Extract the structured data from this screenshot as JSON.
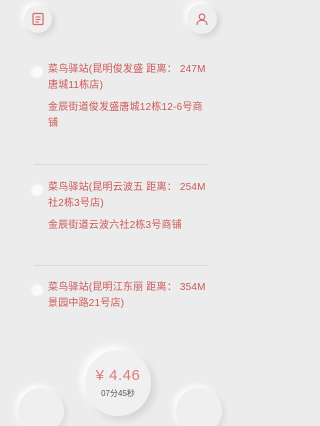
{
  "header": {
    "left_icon": "order-list-icon",
    "right_icon": "user-icon"
  },
  "stations": [
    {
      "title": "菜鸟驿站(昆明俊发盛 距离： 247M",
      "title_line2": "唐城11栋店)",
      "address": "金辰街道俊发盛唐城12栋12-6号商",
      "address_line2": "铺"
    },
    {
      "title": "菜鸟驿站(昆明云波五 距离： 254M",
      "title_line2": "社2栋3号店)",
      "address": "金辰街道云波六社2栋3号商铺",
      "address_line2": ""
    },
    {
      "title": "菜鸟驿站(昆明江东丽 距离： 354M",
      "title_line2": "景园中路21号店)",
      "address": "",
      "address_line2": ""
    }
  ],
  "summary": {
    "price": "¥ 4.46",
    "timer": "07分45秒"
  },
  "colors": {
    "accent": "#cc5858",
    "background": "#ececec"
  }
}
